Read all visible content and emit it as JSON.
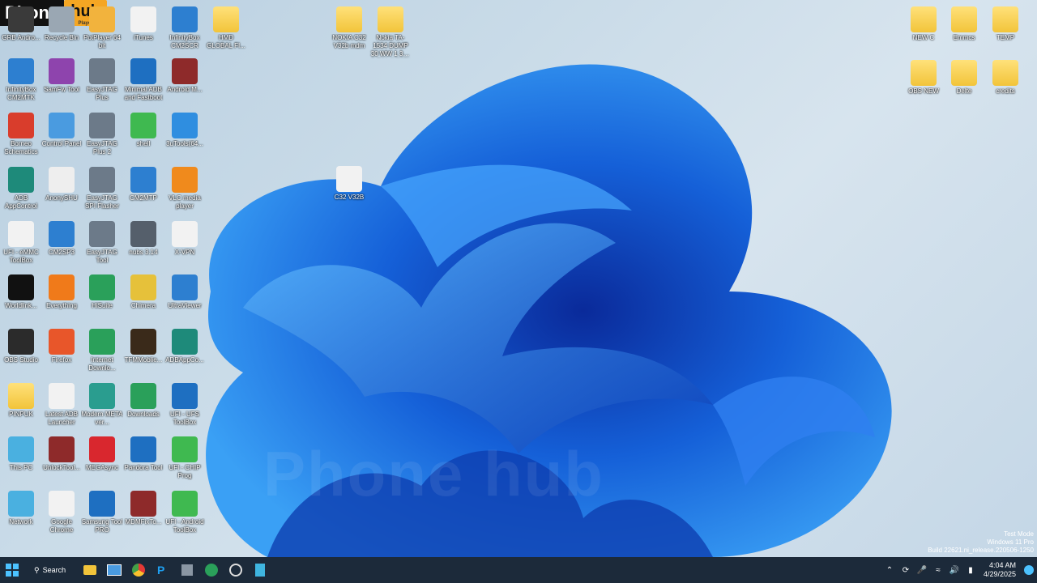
{
  "brand": {
    "part1": "Phone",
    "part2": "hub",
    "sub": "Player"
  },
  "watermark": "Phone hub",
  "desktop_icons": [
    {
      "label": "GRB Andro...",
      "icon": "app-icon",
      "color": "#3a3a3a"
    },
    {
      "label": "Recycle Bin",
      "icon": "recycle-bin-icon",
      "color": "#9aa7b3"
    },
    {
      "label": "PotPlayer 64 bit",
      "icon": "potplayer-icon",
      "color": "#f2b33d"
    },
    {
      "label": "iTunes",
      "icon": "itunes-icon",
      "color": "#f2f2f2"
    },
    {
      "label": "InfinityBox CM2SCR",
      "icon": "infinitybox-icon",
      "color": "#2d7fd0"
    },
    {
      "label": "HMD GLOBAL FI...",
      "icon": "folder-icon",
      "color": "folder"
    },
    {
      "label": "InfinityBox CM2MTK",
      "icon": "infinitybox-icon",
      "color": "#2d7fd0"
    },
    {
      "label": "SamFw Tool",
      "icon": "samfw-icon",
      "color": "#8e44ad"
    },
    {
      "label": "EasyJTAG Plus",
      "icon": "easyjtag-icon",
      "color": "#6c7a89"
    },
    {
      "label": "Minimal ADB and Fastboot",
      "icon": "adb-icon",
      "color": "#1e6fc1"
    },
    {
      "label": "Android M...",
      "icon": "winrar-icon",
      "color": "#8e2a2a"
    },
    {
      "label": "Borneo Schematics",
      "icon": "borneo-icon",
      "color": "#d93d2c"
    },
    {
      "label": "Control Panel",
      "icon": "control-panel-icon",
      "color": "#4a9be0"
    },
    {
      "label": "EasyJTAG Plus 2",
      "icon": "easyjtag-icon",
      "color": "#6c7a89"
    },
    {
      "label": "shell",
      "icon": "shell-icon",
      "color": "#3fb950"
    },
    {
      "label": "3uTools(64...",
      "icon": "3utools-icon",
      "color": "#2f8ee0"
    },
    {
      "label": "ADB AppControl",
      "icon": "android-icon",
      "color": "#1e8a7a"
    },
    {
      "label": "AnonySHU",
      "icon": "shu-icon",
      "color": "#eeeeee"
    },
    {
      "label": "EasyJTAG SPI Flasher",
      "icon": "easyjtag-icon",
      "color": "#6c7a89"
    },
    {
      "label": "CM2MTP",
      "icon": "infinitybox-icon",
      "color": "#2d7fd0"
    },
    {
      "label": "VLC media player",
      "icon": "vlc-icon",
      "color": "#f08a1c"
    },
    {
      "label": "UFI - eMMC ToolBox",
      "icon": "ufi-icon",
      "color": "#f2f2f2"
    },
    {
      "label": "CM2SP3",
      "icon": "infinitybox-icon",
      "color": "#2d7fd0"
    },
    {
      "label": "EasyJTAG Tool",
      "icon": "easyjtag-icon",
      "color": "#6c7a89"
    },
    {
      "label": "nubs 3.14",
      "icon": "usb-icon",
      "color": "#555f6b"
    },
    {
      "label": "X-VPN",
      "icon": "xvpn-icon",
      "color": "#f2f2f2"
    },
    {
      "label": "Worldlink...",
      "icon": "worldlink-icon",
      "color": "#111111"
    },
    {
      "label": "Everything",
      "icon": "everything-icon",
      "color": "#f07a1a"
    },
    {
      "label": "HiSuite",
      "icon": "hisuite-icon",
      "color": "#2aa05a"
    },
    {
      "label": "Chimera",
      "icon": "chimera-icon",
      "color": "#e6c13a"
    },
    {
      "label": "UltraViewer",
      "icon": "ultraviewer-icon",
      "color": "#2d7fd0"
    },
    {
      "label": "OBS Studio",
      "icon": "obs-icon",
      "color": "#2b2b2b"
    },
    {
      "label": "Firefox",
      "icon": "firefox-icon",
      "color": "#e8562a"
    },
    {
      "label": "Internet Downlo...",
      "icon": "idm-icon",
      "color": "#2aa05a"
    },
    {
      "label": "TFMMoblie...",
      "icon": "tfm-icon",
      "color": "#3a2a1a"
    },
    {
      "label": "ADBAppCo...",
      "icon": "android-icon",
      "color": "#1e8a7a"
    },
    {
      "label": "PINPUK",
      "icon": "folder-icon",
      "color": "folder"
    },
    {
      "label": "Latest ADB Launcher",
      "icon": "adb-launcher-icon",
      "color": "#f2f2f2"
    },
    {
      "label": "Modern META ver...",
      "icon": "meta-icon",
      "color": "#2a9d8f"
    },
    {
      "label": "Downloads",
      "icon": "downloads-icon",
      "color": "#2aa05a"
    },
    {
      "label": "UFI - UFS ToolBox",
      "icon": "ufs-icon",
      "color": "#1e6fc1"
    },
    {
      "label": "This PC",
      "icon": "this-pc-icon",
      "color": "#4ab0e0"
    },
    {
      "label": "UnlockTool...",
      "icon": "winrar-icon",
      "color": "#8e2a2a"
    },
    {
      "label": "MEGAsync",
      "icon": "mega-icon",
      "color": "#d9272e"
    },
    {
      "label": "Pandora Tool",
      "icon": "pandora-icon",
      "color": "#1e6fc1"
    },
    {
      "label": "UFI - CHIP Prog",
      "icon": "ufi-chip-icon",
      "color": "#3fb950"
    },
    {
      "label": "Network",
      "icon": "network-icon",
      "color": "#4ab0e0"
    },
    {
      "label": "Google Chrome",
      "icon": "chrome-icon",
      "color": "#f2f2f2"
    },
    {
      "label": "Samsung Tool PRO",
      "icon": "samsung-tool-icon",
      "color": "#1e6fc1"
    },
    {
      "label": "MDMFixTo...",
      "icon": "winrar-icon",
      "color": "#8e2a2a"
    },
    {
      "label": "UFI - Android ToolBox",
      "icon": "ufi-android-icon",
      "color": "#3fb950"
    },
    {
      "label": "NOKIA C32 V32b mdm",
      "icon": "folder-icon",
      "color": "folder"
    },
    {
      "label": "Nokia TA-1534 DUMP 30 WW 1 320 S P01 (V32B)",
      "icon": "folder-icon",
      "color": "folder"
    },
    {
      "label": "C32 V32B",
      "icon": "file-icon",
      "color": "#f2f2f2"
    },
    {
      "label": "NEW C",
      "icon": "folder-icon",
      "color": "folder"
    },
    {
      "label": "Emmcs",
      "icon": "folder-icon",
      "color": "folder"
    },
    {
      "label": "TEMP",
      "icon": "folder-icon",
      "color": "folder"
    },
    {
      "label": "OBS NEW",
      "icon": "folder-icon",
      "color": "folder"
    },
    {
      "label": "Delte",
      "icon": "folder-icon",
      "color": "folder"
    },
    {
      "label": "credits",
      "icon": "folder-icon",
      "color": "folder"
    }
  ],
  "windows_info": {
    "line1": "Test Mode",
    "line2": "Windows 11 Pro",
    "line3": "Build 22621.ni_release.220506-1250"
  },
  "taskbar": {
    "search_label": "Search",
    "apps": [
      "start-icon",
      "file-explorer-icon",
      "control-panel-icon",
      "chrome-icon",
      "pandora-icon",
      "easyjtag-icon",
      "hisuite-icon",
      "obs-icon",
      "notepad-icon"
    ],
    "time": "4:04 AM",
    "date": "4/29/2025"
  }
}
